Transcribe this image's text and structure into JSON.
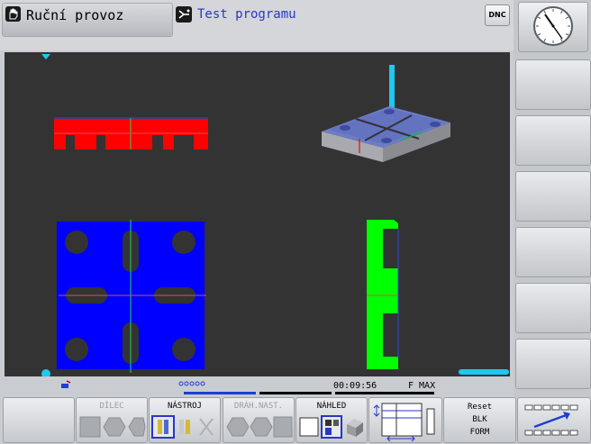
{
  "header": {
    "mode_label": "Ruční provoz",
    "program_label": "Test programu",
    "dnc_label": "DNC"
  },
  "status": {
    "time": "00:09:56",
    "feed": "F MAX"
  },
  "softkeys": {
    "dilec": "DÍLEC",
    "nastroj": "NÁSTROJ",
    "drah_nast": "DRÁH.NAST.",
    "nahled": "NÁHLED",
    "reset_line1": "Reset",
    "reset_line2": "BLK",
    "reset_line3": "FORM"
  },
  "colors": {
    "workpiece_blue": "#0000ff",
    "side_red": "#ff0000",
    "side_green": "#00ff00",
    "tool_cyan": "#1ec8f0",
    "background": "#333333"
  },
  "icons": [
    "hand-mode-icon",
    "program-test-icon",
    "clock-icon",
    "dnc-icon",
    "tool-icon"
  ]
}
